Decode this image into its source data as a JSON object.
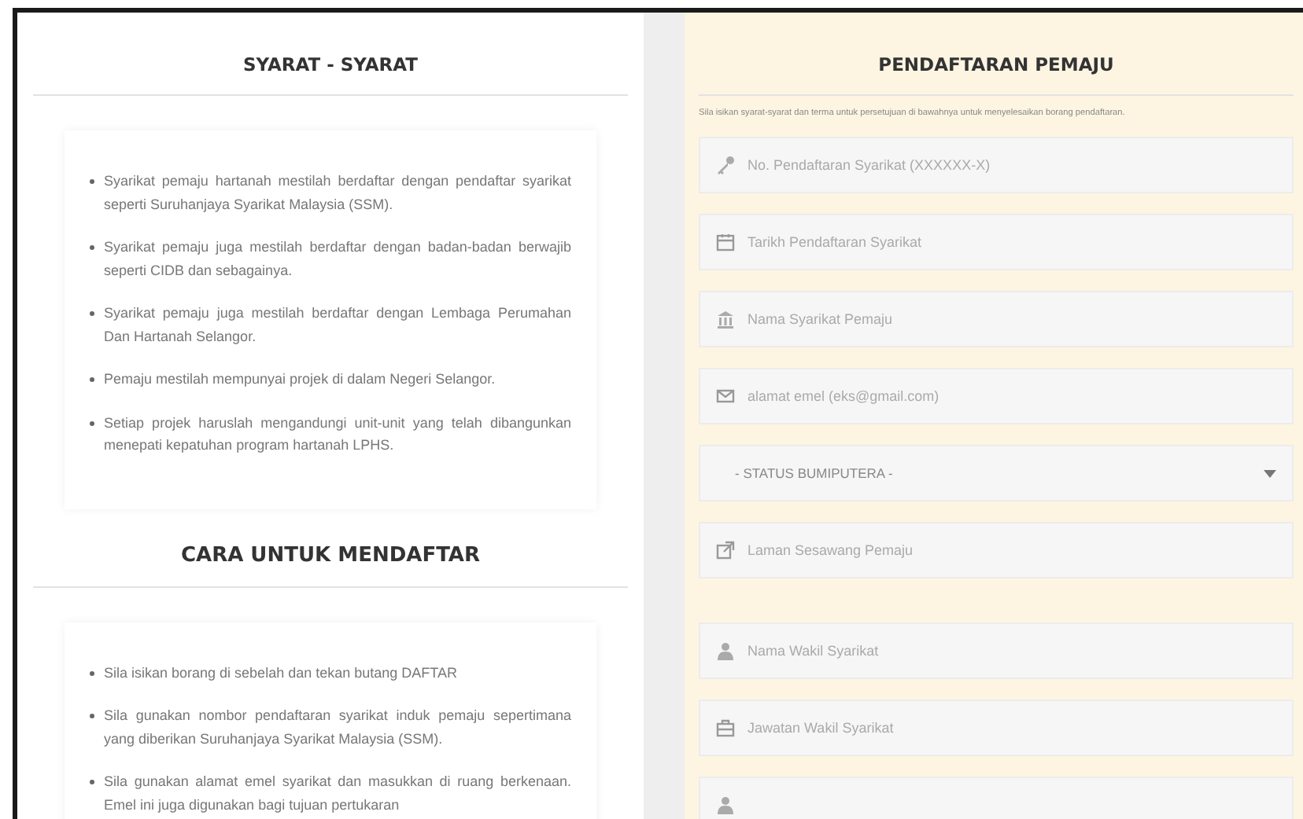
{
  "requirements": {
    "title": "SYARAT - SYARAT",
    "items": [
      "Syarikat pemaju hartanah mestilah berdaftar dengan pendaftar syarikat seperti Suruhanjaya Syarikat Malaysia (SSM).",
      "Syarikat pemaju juga mestilah berdaftar dengan badan-badan berwajib seperti CIDB dan sebagainya.",
      "Syarikat pemaju juga mestilah berdaftar dengan Lembaga Perumahan Dan Hartanah Selangor.",
      "Pemaju mestilah mempunyai projek di dalam Negeri Selangor.",
      "Setiap projek haruslah mengandungi unit-unit yang telah dibangunkan menepati kepatuhan program hartanah LPHS."
    ]
  },
  "how_to_register": {
    "title": "CARA UNTUK MENDAFTAR",
    "items": [
      "Sila isikan borang di sebelah dan tekan butang DAFTAR",
      "Sila gunakan nombor pendaftaran syarikat induk pemaju sepertimana yang diberikan Suruhanjaya Syarikat Malaysia (SSM).",
      "Sila gunakan alamat emel syarikat dan masukkan di ruang berkenaan. Emel ini juga digunakan bagi tujuan pertukaran"
    ]
  },
  "registration": {
    "title": "PENDAFTARAN PEMAJU",
    "intro": "Sila isikan syarat-syarat dan terma untuk persetujuan di bawahnya untuk menyelesaikan borang pendaftaran.",
    "company_fields": [
      {
        "kind": "input",
        "placeholder": "No. Pendaftaran Syarikat (XXXXXX-X)"
      },
      {
        "kind": "input",
        "placeholder": "Tarikh Pendaftaran Syarikat"
      },
      {
        "kind": "input",
        "placeholder": "Nama Syarikat Pemaju"
      },
      {
        "kind": "input",
        "placeholder": "alamat emel (eks@gmail.com)"
      },
      {
        "kind": "select",
        "value": "- STATUS BUMIPUTERA -"
      },
      {
        "kind": "input",
        "placeholder": "Laman Sesawang Pemaju"
      }
    ],
    "representative_fields": [
      {
        "kind": "input",
        "placeholder": "Nama Wakil Syarikat"
      },
      {
        "kind": "input",
        "placeholder": "Jawatan Wakil Syarikat"
      },
      {
        "kind": "input"
      }
    ]
  }
}
